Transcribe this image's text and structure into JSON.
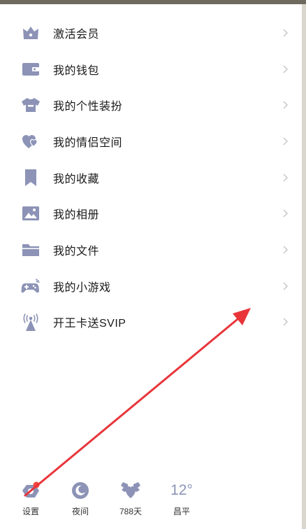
{
  "colors": {
    "icon": "#8c93b6",
    "text": "#1a1a1a",
    "chevron": "#c4c4c4",
    "badge": "#f5463c",
    "annotation": "#e8353a"
  },
  "menu": {
    "items": [
      {
        "label": "激活会员",
        "icon": "crown-icon"
      },
      {
        "label": "我的钱包",
        "icon": "wallet-icon"
      },
      {
        "label": "我的个性装扮",
        "icon": "shirt-icon"
      },
      {
        "label": "我的情侣空间",
        "icon": "hearts-icon"
      },
      {
        "label": "我的收藏",
        "icon": "bookmark-icon"
      },
      {
        "label": "我的相册",
        "icon": "image-icon"
      },
      {
        "label": "我的文件",
        "icon": "folder-icon"
      },
      {
        "label": "我的小游戏",
        "icon": "gamepad-icon"
      },
      {
        "label": "开王卡送SVIP",
        "icon": "broadcast-icon"
      }
    ]
  },
  "bottom": {
    "settings_label": "设置",
    "night_label": "夜间",
    "days_label": "788天",
    "weather_temp": "12°",
    "weather_city": "昌平"
  }
}
